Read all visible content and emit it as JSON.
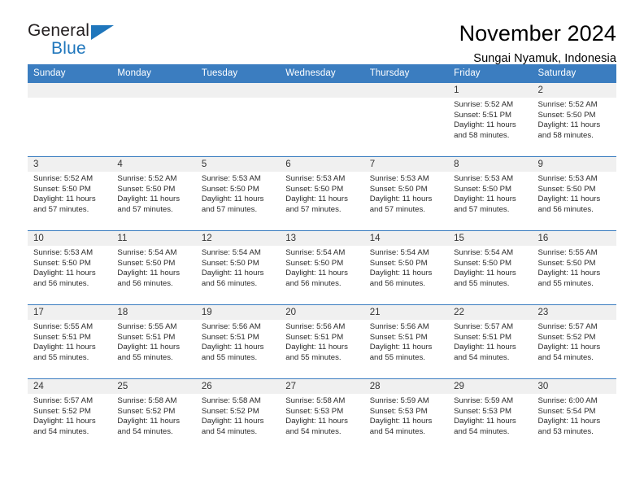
{
  "brand": {
    "word_one": "General",
    "word_two": "Blue",
    "triangle_icon": "triangle-icon",
    "primary_color": "#1f76bc"
  },
  "header": {
    "title": "November 2024",
    "location": "Sungai Nyamuk, Indonesia"
  },
  "theme": {
    "header_blue": "#3b7dc0",
    "daynum_gray": "#f0f0f0"
  },
  "calendar": {
    "weekday_headers": [
      "Sunday",
      "Monday",
      "Tuesday",
      "Wednesday",
      "Thursday",
      "Friday",
      "Saturday"
    ],
    "labels": {
      "sunrise": "Sunrise:",
      "sunset": "Sunset:",
      "daylight": "Daylight:"
    },
    "weeks": [
      [
        {
          "blank": true
        },
        {
          "blank": true
        },
        {
          "blank": true
        },
        {
          "blank": true
        },
        {
          "blank": true
        },
        {
          "day": "1",
          "sunrise": "Sunrise: 5:52 AM",
          "sunset": "Sunset: 5:51 PM",
          "daylight_line1": "Daylight: 11 hours",
          "daylight_line2": "and 58 minutes."
        },
        {
          "day": "2",
          "sunrise": "Sunrise: 5:52 AM",
          "sunset": "Sunset: 5:50 PM",
          "daylight_line1": "Daylight: 11 hours",
          "daylight_line2": "and 58 minutes."
        }
      ],
      [
        {
          "day": "3",
          "sunrise": "Sunrise: 5:52 AM",
          "sunset": "Sunset: 5:50 PM",
          "daylight_line1": "Daylight: 11 hours",
          "daylight_line2": "and 57 minutes."
        },
        {
          "day": "4",
          "sunrise": "Sunrise: 5:52 AM",
          "sunset": "Sunset: 5:50 PM",
          "daylight_line1": "Daylight: 11 hours",
          "daylight_line2": "and 57 minutes."
        },
        {
          "day": "5",
          "sunrise": "Sunrise: 5:53 AM",
          "sunset": "Sunset: 5:50 PM",
          "daylight_line1": "Daylight: 11 hours",
          "daylight_line2": "and 57 minutes."
        },
        {
          "day": "6",
          "sunrise": "Sunrise: 5:53 AM",
          "sunset": "Sunset: 5:50 PM",
          "daylight_line1": "Daylight: 11 hours",
          "daylight_line2": "and 57 minutes."
        },
        {
          "day": "7",
          "sunrise": "Sunrise: 5:53 AM",
          "sunset": "Sunset: 5:50 PM",
          "daylight_line1": "Daylight: 11 hours",
          "daylight_line2": "and 57 minutes."
        },
        {
          "day": "8",
          "sunrise": "Sunrise: 5:53 AM",
          "sunset": "Sunset: 5:50 PM",
          "daylight_line1": "Daylight: 11 hours",
          "daylight_line2": "and 57 minutes."
        },
        {
          "day": "9",
          "sunrise": "Sunrise: 5:53 AM",
          "sunset": "Sunset: 5:50 PM",
          "daylight_line1": "Daylight: 11 hours",
          "daylight_line2": "and 56 minutes."
        }
      ],
      [
        {
          "day": "10",
          "sunrise": "Sunrise: 5:53 AM",
          "sunset": "Sunset: 5:50 PM",
          "daylight_line1": "Daylight: 11 hours",
          "daylight_line2": "and 56 minutes."
        },
        {
          "day": "11",
          "sunrise": "Sunrise: 5:54 AM",
          "sunset": "Sunset: 5:50 PM",
          "daylight_line1": "Daylight: 11 hours",
          "daylight_line2": "and 56 minutes."
        },
        {
          "day": "12",
          "sunrise": "Sunrise: 5:54 AM",
          "sunset": "Sunset: 5:50 PM",
          "daylight_line1": "Daylight: 11 hours",
          "daylight_line2": "and 56 minutes."
        },
        {
          "day": "13",
          "sunrise": "Sunrise: 5:54 AM",
          "sunset": "Sunset: 5:50 PM",
          "daylight_line1": "Daylight: 11 hours",
          "daylight_line2": "and 56 minutes."
        },
        {
          "day": "14",
          "sunrise": "Sunrise: 5:54 AM",
          "sunset": "Sunset: 5:50 PM",
          "daylight_line1": "Daylight: 11 hours",
          "daylight_line2": "and 56 minutes."
        },
        {
          "day": "15",
          "sunrise": "Sunrise: 5:54 AM",
          "sunset": "Sunset: 5:50 PM",
          "daylight_line1": "Daylight: 11 hours",
          "daylight_line2": "and 55 minutes."
        },
        {
          "day": "16",
          "sunrise": "Sunrise: 5:55 AM",
          "sunset": "Sunset: 5:50 PM",
          "daylight_line1": "Daylight: 11 hours",
          "daylight_line2": "and 55 minutes."
        }
      ],
      [
        {
          "day": "17",
          "sunrise": "Sunrise: 5:55 AM",
          "sunset": "Sunset: 5:51 PM",
          "daylight_line1": "Daylight: 11 hours",
          "daylight_line2": "and 55 minutes."
        },
        {
          "day": "18",
          "sunrise": "Sunrise: 5:55 AM",
          "sunset": "Sunset: 5:51 PM",
          "daylight_line1": "Daylight: 11 hours",
          "daylight_line2": "and 55 minutes."
        },
        {
          "day": "19",
          "sunrise": "Sunrise: 5:56 AM",
          "sunset": "Sunset: 5:51 PM",
          "daylight_line1": "Daylight: 11 hours",
          "daylight_line2": "and 55 minutes."
        },
        {
          "day": "20",
          "sunrise": "Sunrise: 5:56 AM",
          "sunset": "Sunset: 5:51 PM",
          "daylight_line1": "Daylight: 11 hours",
          "daylight_line2": "and 55 minutes."
        },
        {
          "day": "21",
          "sunrise": "Sunrise: 5:56 AM",
          "sunset": "Sunset: 5:51 PM",
          "daylight_line1": "Daylight: 11 hours",
          "daylight_line2": "and 55 minutes."
        },
        {
          "day": "22",
          "sunrise": "Sunrise: 5:57 AM",
          "sunset": "Sunset: 5:51 PM",
          "daylight_line1": "Daylight: 11 hours",
          "daylight_line2": "and 54 minutes."
        },
        {
          "day": "23",
          "sunrise": "Sunrise: 5:57 AM",
          "sunset": "Sunset: 5:52 PM",
          "daylight_line1": "Daylight: 11 hours",
          "daylight_line2": "and 54 minutes."
        }
      ],
      [
        {
          "day": "24",
          "sunrise": "Sunrise: 5:57 AM",
          "sunset": "Sunset: 5:52 PM",
          "daylight_line1": "Daylight: 11 hours",
          "daylight_line2": "and 54 minutes."
        },
        {
          "day": "25",
          "sunrise": "Sunrise: 5:58 AM",
          "sunset": "Sunset: 5:52 PM",
          "daylight_line1": "Daylight: 11 hours",
          "daylight_line2": "and 54 minutes."
        },
        {
          "day": "26",
          "sunrise": "Sunrise: 5:58 AM",
          "sunset": "Sunset: 5:52 PM",
          "daylight_line1": "Daylight: 11 hours",
          "daylight_line2": "and 54 minutes."
        },
        {
          "day": "27",
          "sunrise": "Sunrise: 5:58 AM",
          "sunset": "Sunset: 5:53 PM",
          "daylight_line1": "Daylight: 11 hours",
          "daylight_line2": "and 54 minutes."
        },
        {
          "day": "28",
          "sunrise": "Sunrise: 5:59 AM",
          "sunset": "Sunset: 5:53 PM",
          "daylight_line1": "Daylight: 11 hours",
          "daylight_line2": "and 54 minutes."
        },
        {
          "day": "29",
          "sunrise": "Sunrise: 5:59 AM",
          "sunset": "Sunset: 5:53 PM",
          "daylight_line1": "Daylight: 11 hours",
          "daylight_line2": "and 54 minutes."
        },
        {
          "day": "30",
          "sunrise": "Sunrise: 6:00 AM",
          "sunset": "Sunset: 5:54 PM",
          "daylight_line1": "Daylight: 11 hours",
          "daylight_line2": "and 53 minutes."
        }
      ]
    ]
  }
}
